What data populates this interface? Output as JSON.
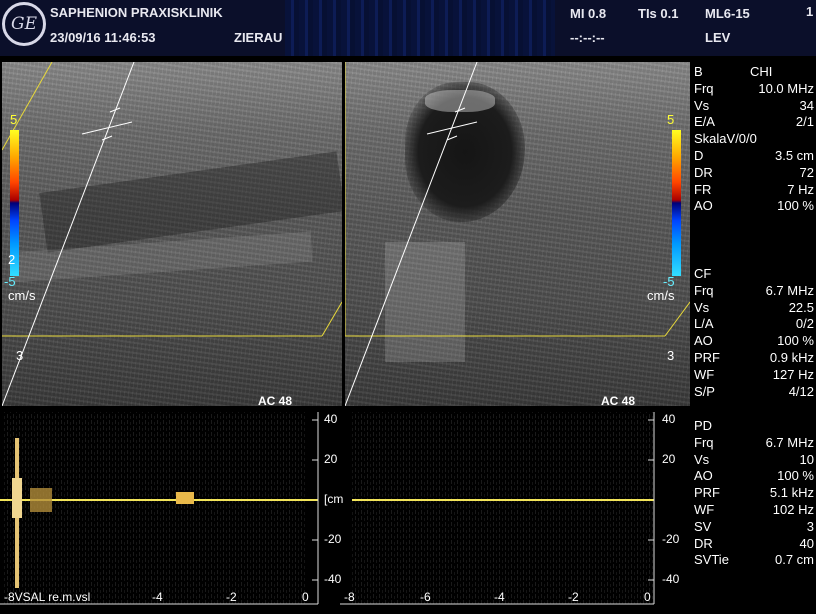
{
  "header": {
    "clinic": "SAPHENION PRAXISKLINIK",
    "datetime": "23/09/16 11:46:53",
    "operator": "ZIERAU",
    "mi": "MI 0.8",
    "tis": "TIs 0.1",
    "probe": "ML6-15",
    "page_num": "1",
    "time_placeholder": "--:--:--",
    "side": "LEV"
  },
  "color_scale": {
    "top": "5",
    "bottom": "-5",
    "unit": "cm/s",
    "mid": "2"
  },
  "depth_marks": {
    "m3": "3"
  },
  "panel_label": "AC 48",
  "b_mode": {
    "title_left": "B",
    "title_right": "CHI",
    "rows": [
      {
        "k": "Frq",
        "v": "10.0 MHz"
      },
      {
        "k": "Vs",
        "v": "34"
      },
      {
        "k": "E/A",
        "v": "2/1"
      },
      {
        "k": "SkalaV/0/0",
        "v": ""
      },
      {
        "k": "D",
        "v": "3.5 cm"
      },
      {
        "k": "DR",
        "v": "72"
      },
      {
        "k": "FR",
        "v": "7 Hz"
      },
      {
        "k": "AO",
        "v": "100 %"
      }
    ]
  },
  "cf_mode": {
    "title": "CF",
    "rows": [
      {
        "k": "Frq",
        "v": "6.7 MHz"
      },
      {
        "k": "Vs",
        "v": "22.5"
      },
      {
        "k": "L/A",
        "v": "0/2"
      },
      {
        "k": "AO",
        "v": "100 %"
      },
      {
        "k": "PRF",
        "v": "0.9 kHz"
      },
      {
        "k": "WF",
        "v": "127 Hz"
      },
      {
        "k": "S/P",
        "v": "4/12"
      }
    ]
  },
  "pd_mode": {
    "title": "PD",
    "rows": [
      {
        "k": "Frq",
        "v": "6.7 MHz"
      },
      {
        "k": "Vs",
        "v": "10"
      },
      {
        "k": "AO",
        "v": "100 %"
      },
      {
        "k": "PRF",
        "v": "5.1 kHz"
      },
      {
        "k": "WF",
        "v": "102 Hz"
      },
      {
        "k": "SV",
        "v": "3"
      },
      {
        "k": "DR",
        "v": "40"
      },
      {
        "k": "SVTie",
        "v": "0.7 cm"
      }
    ]
  },
  "doppler": {
    "y_ticks": [
      "40",
      "20",
      "[cm",
      "-20",
      "-40"
    ],
    "unit": "[cm",
    "x_ticks_left": [
      "-4",
      "-2",
      "0"
    ],
    "x_ticks_right": [
      "-8",
      "-6",
      "-4",
      "-2",
      "0"
    ],
    "footer_label": "-8VSAL re.m.vsl"
  }
}
